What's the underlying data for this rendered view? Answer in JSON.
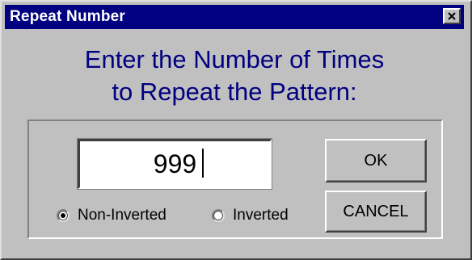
{
  "window": {
    "title": "Repeat Number",
    "close_symbol": "×"
  },
  "prompt": {
    "line1": "Enter the Number of Times",
    "line2": "to Repeat the Pattern:"
  },
  "input": {
    "value": "999"
  },
  "buttons": {
    "ok_label": "OK",
    "cancel_label": "CANCEL"
  },
  "radios": {
    "non_inverted_label": "Non-Inverted",
    "inverted_label": "Inverted",
    "selected": "non_inverted"
  },
  "colors": {
    "title_bar": "#000080",
    "prompt_text": "#000080",
    "dialog_face": "#c0c0c0"
  },
  "icons": {
    "close": "close-icon",
    "radio_selected": "radio-selected-icon"
  }
}
